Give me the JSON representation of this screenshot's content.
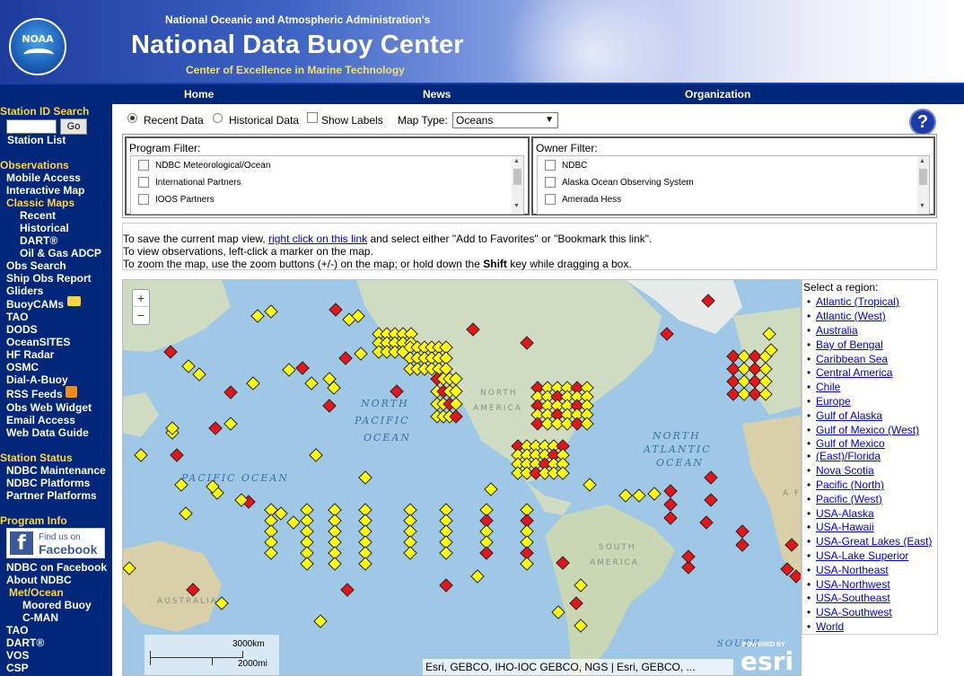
{
  "header": {
    "agency": "National Oceanic and Atmospheric Administration's",
    "title": "National Data Buoy Center",
    "tagline": "Center of Excellence in Marine Technology",
    "logo_text": "NOAA"
  },
  "nav": {
    "items": [
      "Home",
      "News",
      "Organization"
    ]
  },
  "sidebar": {
    "station_search_title": "Station ID Search",
    "go_label": "Go",
    "station_list": "Station List",
    "observations_title": "Observations",
    "mobile_access": "Mobile Access",
    "interactive_map": "Interactive Map",
    "classic_maps": "Classic Maps",
    "recent": "Recent",
    "historical": "Historical",
    "dart": "DART®",
    "oil_gas": "Oil & Gas ADCP",
    "obs_search": "Obs Search",
    "ship_obs": "Ship Obs Report",
    "gliders": "Gliders",
    "buoycams": "BuoyCAMs",
    "tao": "TAO",
    "dods": "DODS",
    "oceansites": "OceanSITES",
    "hf_radar": "HF Radar",
    "osmc": "OSMC",
    "dial_a_buoy": "Dial-A-Buoy",
    "rss_feeds": "RSS Feeds",
    "obs_web_widget": "Obs Web Widget",
    "email_access": "Email Access",
    "web_data_guide": "Web Data Guide",
    "station_status_title": "Station Status",
    "ndbc_maintenance": "NDBC Maintenance",
    "ndbc_platforms": "NDBC Platforms",
    "partner_platforms": "Partner Platforms",
    "program_info_title": "Program Info",
    "fb_find": "Find us on",
    "fb_name": "Facebook",
    "ndbc_on_facebook": "NDBC on Facebook",
    "about_ndbc": "About NDBC",
    "met_ocean": "Met/Ocean",
    "moored_buoy": "Moored Buoy",
    "cman": "C-MAN",
    "tao2": "TAO",
    "dart2": "DART®",
    "vos": "VOS",
    "csp": "CSP"
  },
  "controls": {
    "recent_data": "Recent Data",
    "historical_data": "Historical Data",
    "show_labels": "Show Labels",
    "map_type_label": "Map Type:",
    "map_type_value": "Oceans",
    "help": "?"
  },
  "program_filter": {
    "title": "Program Filter:",
    "items": [
      "NDBC Meteorological/Ocean",
      "International Partners",
      "IOOS Partners"
    ]
  },
  "owner_filter": {
    "title": "Owner Filter:",
    "items": [
      "NDBC",
      "Alaska Ocean Observing System",
      "Amerada Hess"
    ]
  },
  "info": {
    "line1_a": "To save the current map view, ",
    "line1_link": "right click on this link",
    "line1_b": " and select either \"Add to Favorites\" or \"Bookmark this link\".",
    "line2": "To view observations, left-click a marker on the map.",
    "line3_a": "To zoom the map, use the zoom buttons (+/-) on the map; or hold down the ",
    "line3_bold": "Shift",
    "line3_b": " key while dragging a box."
  },
  "map": {
    "zoom_in": "+",
    "zoom_out": "−",
    "labels": {
      "north_pacific_1": "NORTH",
      "north_pacific_2": "PACIFIC",
      "north_pacific_3": "OCEAN",
      "north_atlantic_1": "NORTH",
      "north_atlantic_2": "ATLANTIC",
      "north_atlantic_3": "OCEAN",
      "pacific_ocean": "PACIFIC OCEAN",
      "north_america_1": "NORTH",
      "north_america_2": "AMERICA",
      "south_america_1": "SOUTH",
      "south_america_2": "AMERICA",
      "australia": "AUSTRALIA",
      "south_atlantic": "SOUTH",
      "africa": "A F"
    },
    "scale_km": "3000km",
    "scale_mi": "2000mi",
    "attribution": "Esri, GEBCO, IHO-IOC GEBCO, NGS | Esri, GEBCO, ...",
    "powered_by": "POWERED BY",
    "esri": "esri",
    "colors": {
      "ocean": "#9fc8e6",
      "land": "#cfdcc1",
      "marker_recent": "#ffff00",
      "marker_other": "#e8141a"
    }
  },
  "regions": {
    "title": "Select a region:",
    "items": [
      "Atlantic (Tropical)",
      "Atlantic (West)",
      "Australia",
      "Bay of Bengal",
      "Caribbean Sea",
      "Central America",
      "Chile",
      "Europe",
      "Gulf of Alaska",
      "Gulf of Mexico (West)",
      "Gulf of Mexico",
      "(East)/Florida",
      "Nova Scotia",
      "Pacific (North)",
      "Pacific (West)",
      "USA-Alaska",
      "USA-Hawaii",
      "USA-Great Lakes (East)",
      "USA-Lake Superior",
      "USA-Northeast",
      "USA-Northwest",
      "USA-Southeast",
      "USA-Southwest",
      "World"
    ]
  }
}
